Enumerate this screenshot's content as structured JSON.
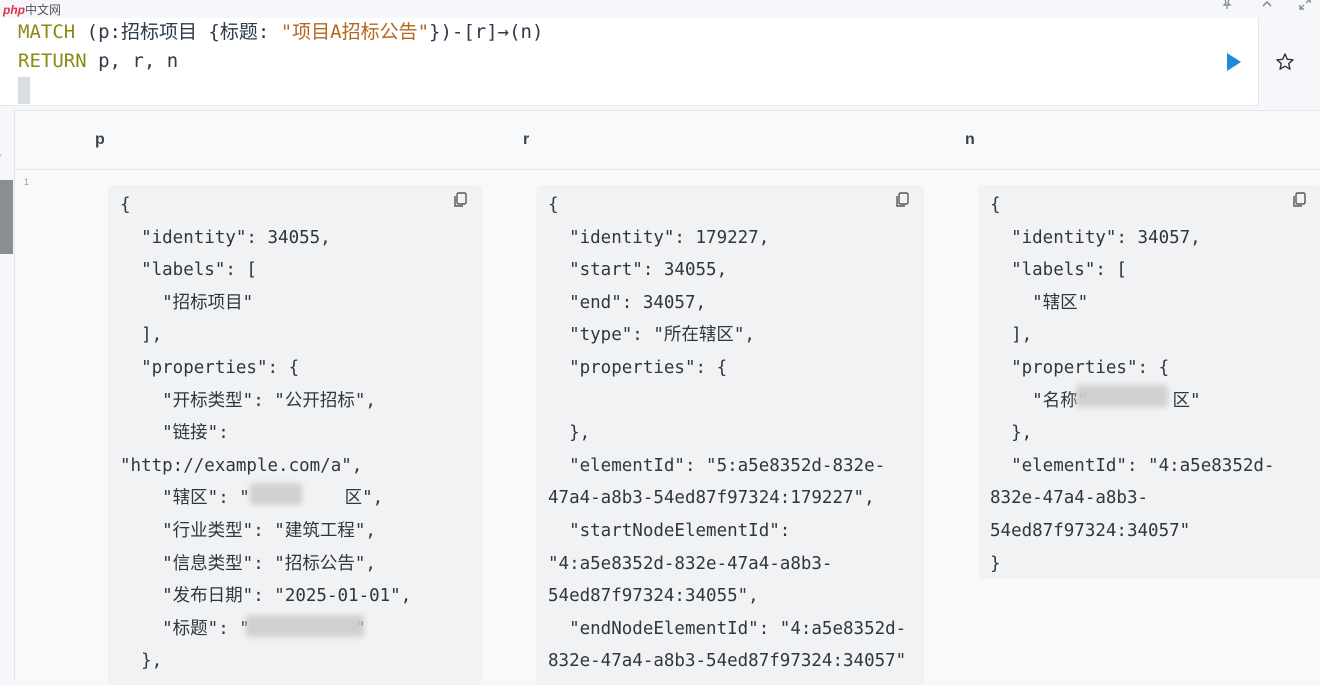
{
  "watermark": {
    "brand": "php",
    "site": "中文网"
  },
  "editor": {
    "match_kw": "MATCH",
    "pattern_start": " (p:招标项目 {标题: ",
    "pattern_string": "\"项目A招标公告\"",
    "pattern_end": "})-[r]→(n)",
    "return_kw": "RETURN",
    "return_vars": " p, r, n"
  },
  "icons": {
    "run": "play-icon",
    "favorite": "star-icon",
    "pin": "pin-icon",
    "collapse": "chevron-up-icon",
    "expand": "expand-icon",
    "copy": "copy-icon"
  },
  "colors": {
    "run_button": "#1a8cd8",
    "keyword": "#8a8a14",
    "string": "#b5651d"
  },
  "result": {
    "columns": [
      "p",
      "r",
      "n"
    ],
    "row_number": "1",
    "cells": {
      "p": "{\n  \"identity\": 34055,\n  \"labels\": [\n    \"招标项目\"\n  ],\n  \"properties\": {\n    \"开标类型\": \"公开招标\",\n    \"链接\":\n\"http://example.com/a\",\n    \"辖区\": \"         区\",\n    \"行业类型\": \"建筑工程\",\n    \"信息类型\": \"招标公告\",\n    \"发布日期\": \"2025-01-01\",\n    \"标题\": \"          \"\n  },",
      "r": "{\n  \"identity\": 179227,\n  \"start\": 34055,\n  \"end\": 34057,\n  \"type\": \"所在辖区\",\n  \"properties\": {\n\n  },\n  \"elementId\": \"5:a5e8352d-832e-\n47a4-a8b3-54ed87f97324:179227\",\n  \"startNodeElementId\":\n\"4:a5e8352d-832e-47a4-a8b3-\n54ed87f97324:34055\",\n  \"endNodeElementId\": \"4:a5e8352d-\n832e-47a4-a8b3-54ed87f97324:34057\"",
      "n": "{\n  \"identity\": 34057,\n  \"labels\": [\n    \"辖区\"\n  ],\n  \"properties\": {\n    \"名称\"        区\"\n  },\n  \"elementId\": \"4:a5e8352d-\n832e-47a4-a8b3-\n54ed87f97324:34057\"\n}"
    }
  }
}
